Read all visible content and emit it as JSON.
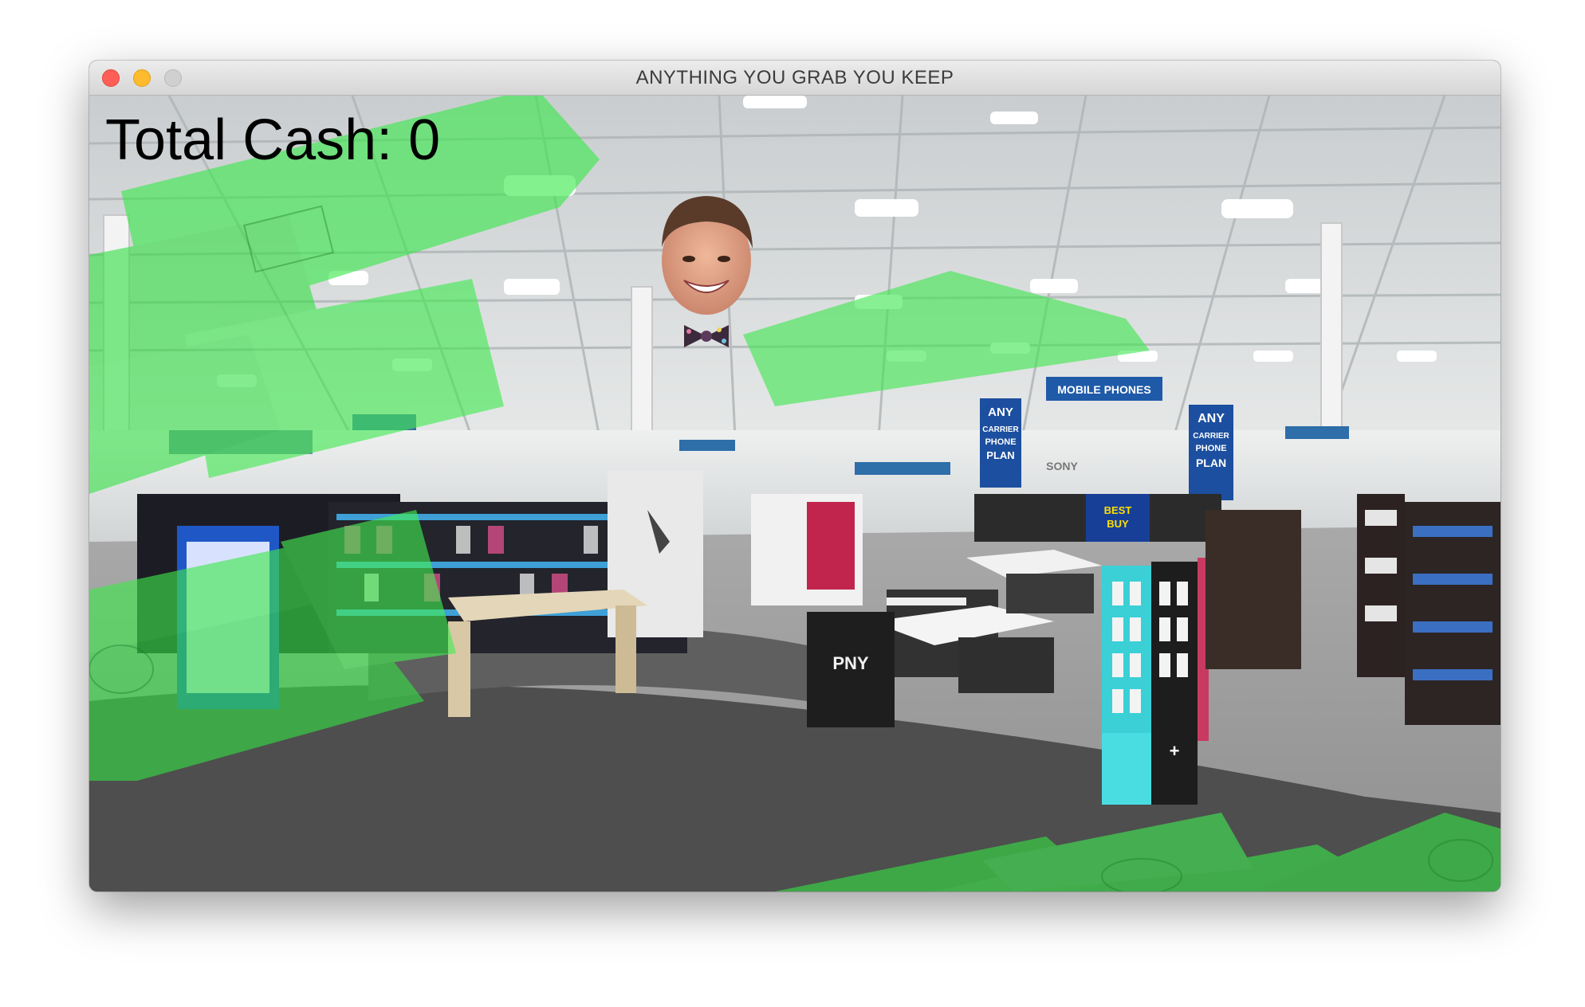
{
  "window": {
    "title": "ANYTHING YOU GRAB YOU KEEP"
  },
  "hud": {
    "cash_label": "Total Cash: 0"
  },
  "store_signs": {
    "mobile_phones": "MOBILE PHONES",
    "plan_left": [
      "ANY",
      "CARRIER",
      "PHONE",
      "PLAN"
    ],
    "plan_right": [
      "ANY",
      "CARRIER",
      "PHONE",
      "PLAN"
    ],
    "best_buy": [
      "BEST",
      "BUY"
    ],
    "pny": "PNY",
    "sony": "SONY"
  },
  "colors": {
    "cash_green": "#38e84a",
    "sign_blue": "#1d4fa8",
    "floor_light": "#a5a5a5",
    "floor_dark": "#4e4e4e",
    "ceiling": "#cfd3d4"
  }
}
